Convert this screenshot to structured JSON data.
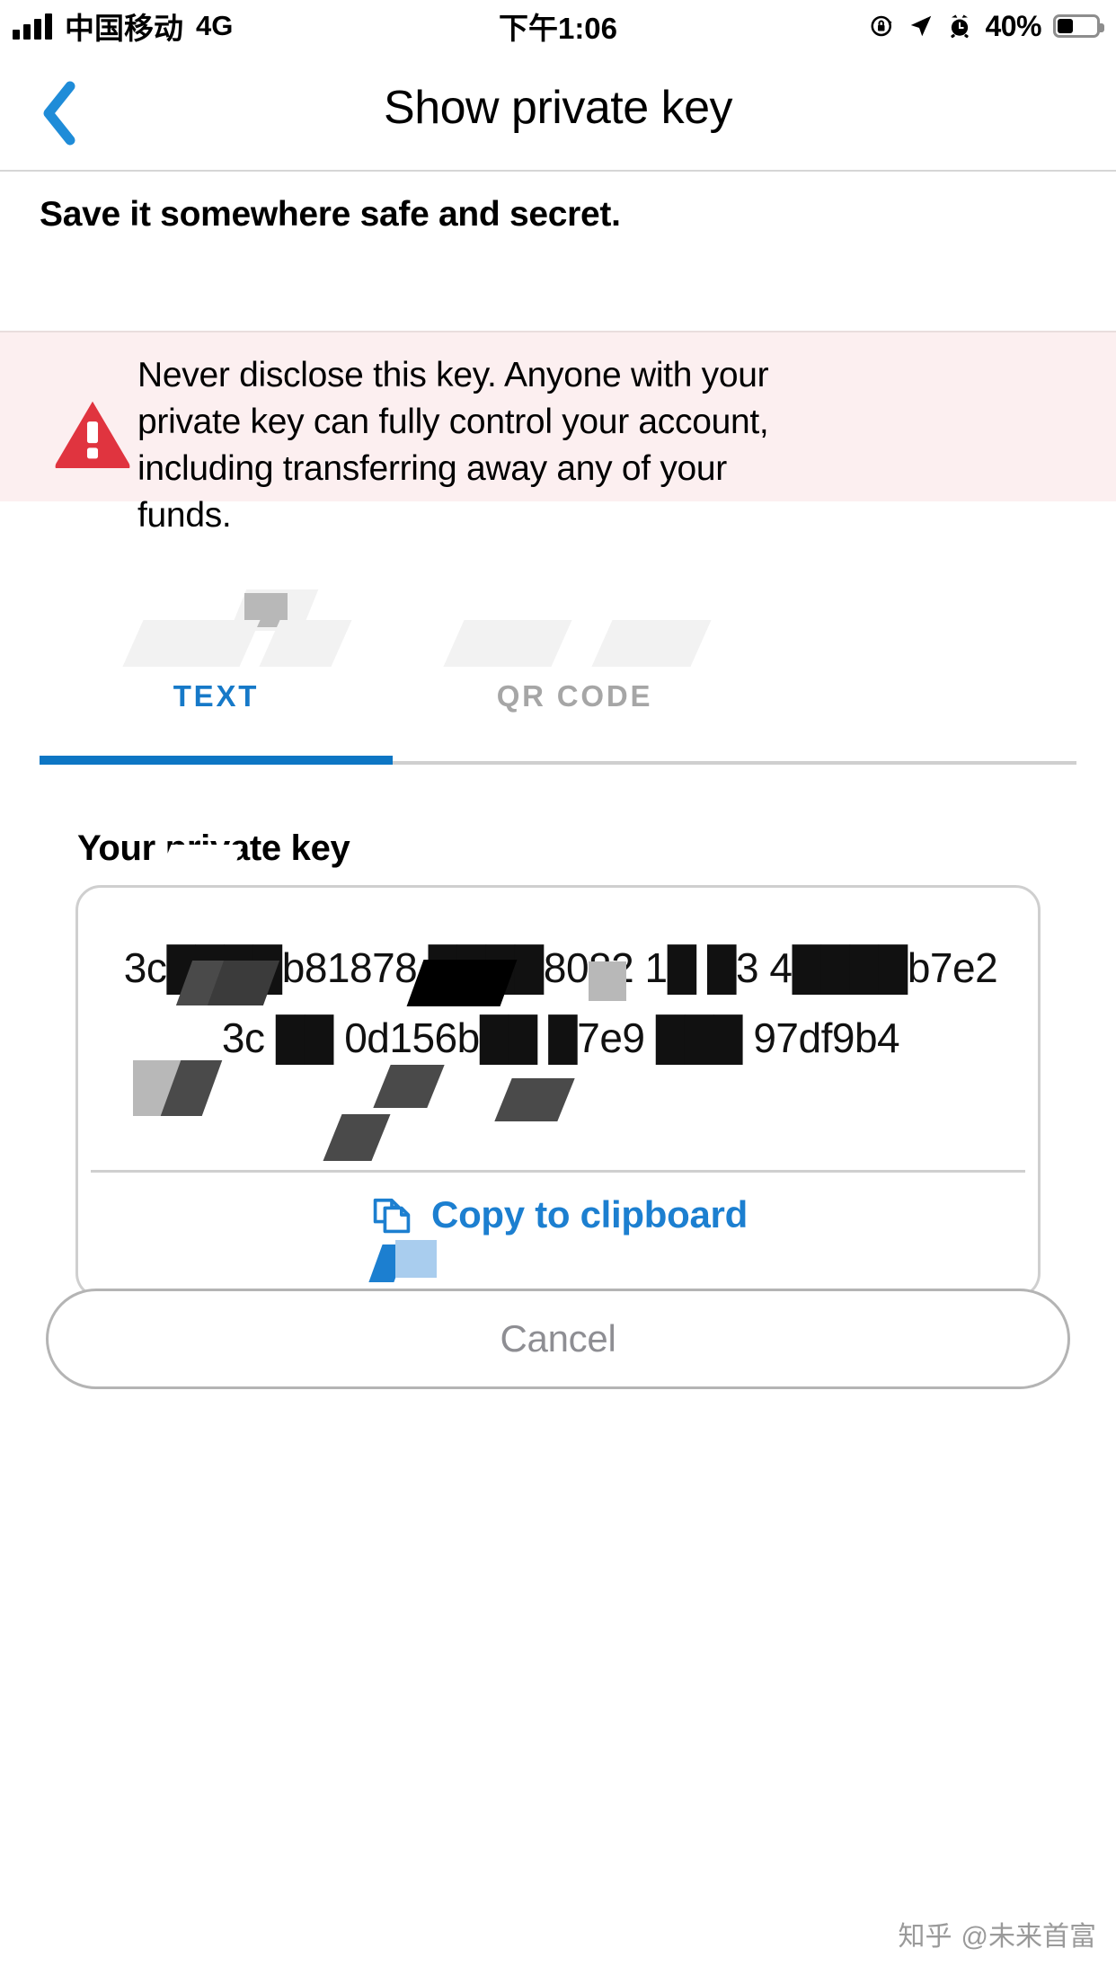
{
  "status_bar": {
    "carrier": "中国移动",
    "network": "4G",
    "time": "下午1:06",
    "battery_percent": "40%",
    "icons": [
      "signal-bars-icon",
      "rotation-lock-icon",
      "location-arrow-icon",
      "alarm-clock-icon",
      "battery-icon"
    ]
  },
  "navbar": {
    "back_label": "chevron-left-icon",
    "title": "Show private key"
  },
  "subtitle": "Save it somewhere safe and secret.",
  "warning": {
    "icon": "warning-triangle-icon",
    "text": "Never disclose this key. Anyone with your private key can fully control your account, including transferring away any of your funds.",
    "background": "#fceff0",
    "icon_color": "#e0343f"
  },
  "tabs": {
    "active_index": 0,
    "items": [
      {
        "label": "TEXT",
        "active": true
      },
      {
        "label": "QR CODE",
        "active": false
      }
    ],
    "active_color": "#1679c8",
    "inactive_color": "#a6a6a6"
  },
  "key_section": {
    "label": "Your private key",
    "value": "3c████b81878 ████8082 1█ █3 4████b7e23c ██ 0d156b██ █7e9 ███ 97df9b4",
    "copy_label": "Copy to clipboard",
    "copy_icon": "copy-icon",
    "copy_color": "#1c7fd0"
  },
  "cancel": {
    "label": "Cancel"
  },
  "watermark": {
    "logo": "知乎",
    "text": "@未来首富"
  }
}
